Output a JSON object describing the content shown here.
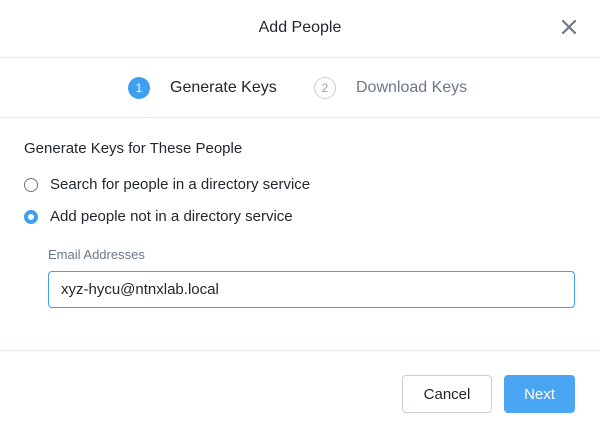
{
  "dialog": {
    "title": "Add People"
  },
  "steps": [
    {
      "number": "1",
      "label": "Generate Keys",
      "active": true
    },
    {
      "number": "2",
      "label": "Download Keys",
      "active": false
    }
  ],
  "form": {
    "section_title": "Generate Keys for These People",
    "options": [
      {
        "label": "Search for people in a directory service",
        "selected": false
      },
      {
        "label": "Add people not in a directory service",
        "selected": true
      }
    ],
    "email_label": "Email Addresses",
    "email_value": "xyz-hycu@ntnxlab.local"
  },
  "footer": {
    "cancel_label": "Cancel",
    "next_label": "Next"
  },
  "colors": {
    "accent": "#3f9ff0",
    "primary_button": "#4aa6f2",
    "text": "#22272e",
    "muted_text": "#6d7889"
  },
  "icons": {
    "close": "close-icon"
  }
}
